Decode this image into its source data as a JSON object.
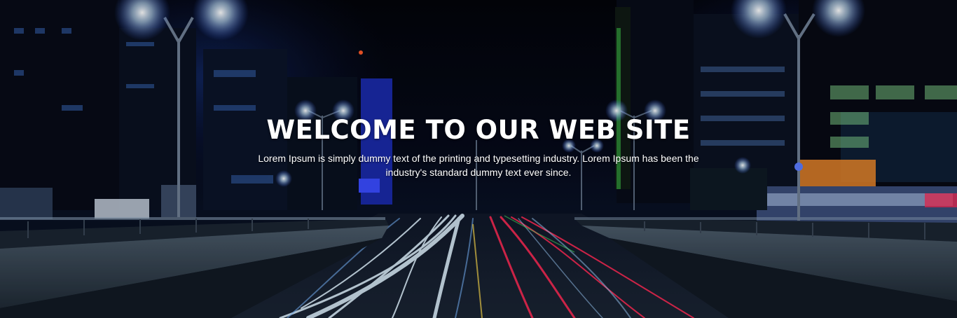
{
  "hero": {
    "title": "WELCOME TO OUR WEB SITE",
    "description": "Lorem Ipsum is simply dummy text of the printing and typesetting industry. Lorem Ipsum has been the industry's standard dummy text ever since.",
    "background_image": "night-city-highway-light-trails"
  },
  "colors": {
    "text": "#ffffff",
    "sky": "#03040a",
    "streetlight": "#cfe6ff",
    "trail_white": "#dff2ff",
    "trail_red": "#ff2a55"
  }
}
